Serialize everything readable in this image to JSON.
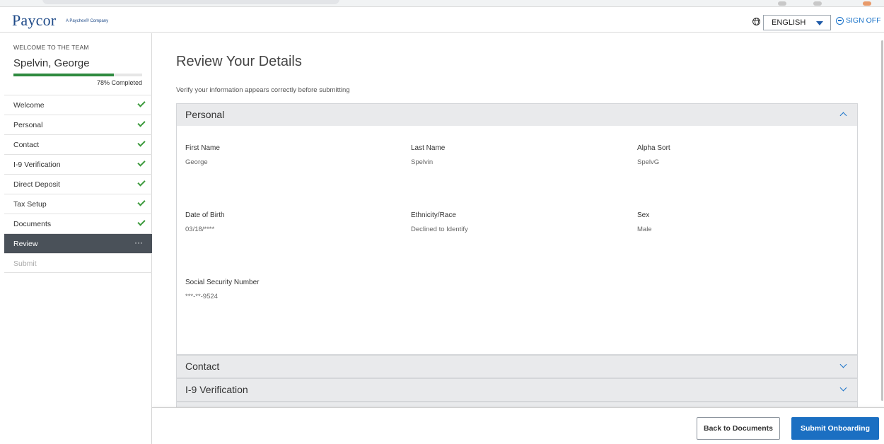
{
  "header": {
    "logo_text": "Paycor",
    "logo_sub": "A Paychex® Company",
    "language": "ENGLISH",
    "sign_off": "SIGN OFF"
  },
  "sidebar": {
    "welcome_label": "WELCOME TO THE TEAM",
    "user_name": "Spelvin, George",
    "progress_percent": 78,
    "progress_text": "78% Completed",
    "steps": [
      {
        "label": "Welcome",
        "state": "complete"
      },
      {
        "label": "Personal",
        "state": "complete"
      },
      {
        "label": "Contact",
        "state": "complete"
      },
      {
        "label": "I-9 Verification",
        "state": "complete"
      },
      {
        "label": "Direct Deposit",
        "state": "complete"
      },
      {
        "label": "Tax Setup",
        "state": "complete"
      },
      {
        "label": "Documents",
        "state": "complete"
      },
      {
        "label": "Review",
        "state": "active",
        "more": "···"
      },
      {
        "label": "Submit",
        "state": "disabled"
      }
    ]
  },
  "main": {
    "title": "Review Your Details",
    "subtitle": "Verify your information appears correctly before submitting",
    "personal": {
      "heading": "Personal",
      "first_name_label": "First Name",
      "first_name": "George",
      "last_name_label": "Last Name",
      "last_name": "Spelvin",
      "alpha_sort_label": "Alpha Sort",
      "alpha_sort": "SpelvG",
      "dob_label": "Date of Birth",
      "dob": "03/18/****",
      "ethnicity_label": "Ethnicity/Race",
      "ethnicity": "Declined to Identify",
      "sex_label": "Sex",
      "sex": "Male",
      "ssn_label": "Social Security Number",
      "ssn": "***-**-9524"
    },
    "contact_heading": "Contact",
    "i9_heading": "I-9 Verification"
  },
  "footer": {
    "back_label": "Back to Documents",
    "submit_label": "Submit Onboarding"
  },
  "colors": {
    "brand": "#1e4a88",
    "primary_button": "#1b6fc2",
    "progress": "#2e8a3f",
    "active_step": "#4a5159"
  }
}
